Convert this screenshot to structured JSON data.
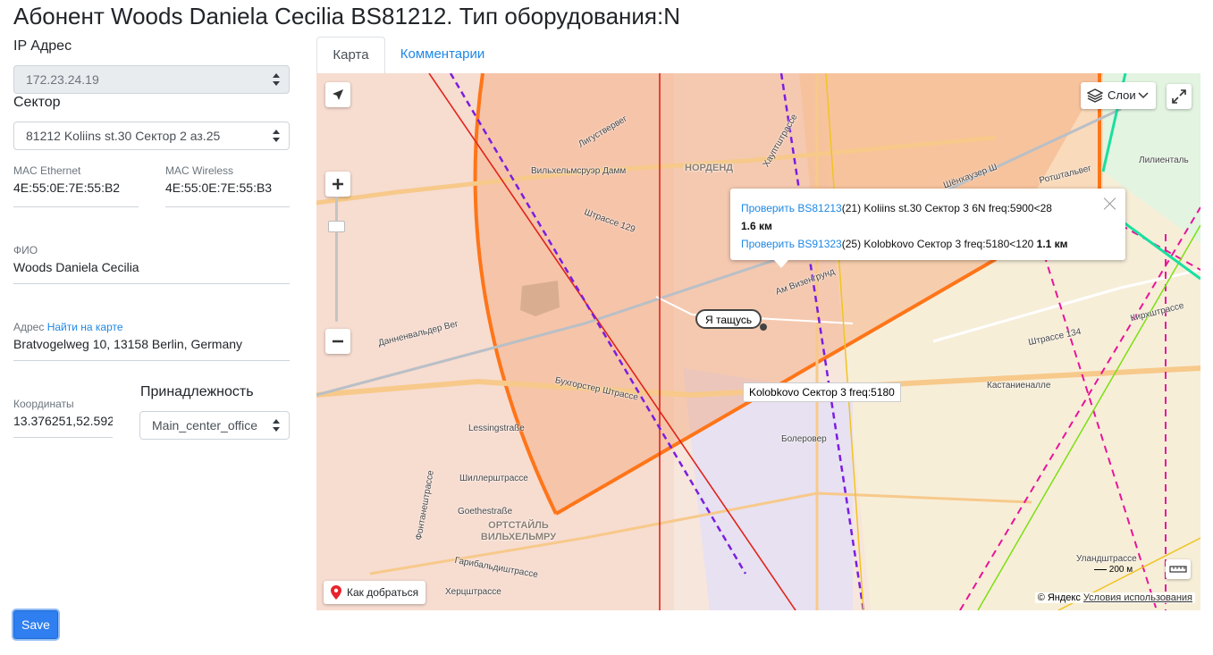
{
  "page": {
    "title": "Абонент Woods Daniela Cecilia BS81212. Тип оборудования:N"
  },
  "form": {
    "ip_label": "IP Адрес",
    "ip_value": "172.23.24.19",
    "sector_label": "Сектор",
    "sector_value": "81212 Koliins st.30 Сектор 2 аз.25",
    "mac_eth_label": "MAC Ethernet",
    "mac_eth_value": "4E:55:0E:7E:55:B2",
    "mac_wifi_label": "MAC Wireless",
    "mac_wifi_value": "4E:55:0E:7E:55:B3",
    "fio_label": "ФИО",
    "fio_value": "Woods Daniela Cecilia",
    "address_label": "Адрес",
    "address_link": "Найти на карте",
    "address_value": "Bratvogelweg 10, 13158 Berlin, Germany",
    "coords_label": "Координаты",
    "coords_value": "13.376251,52.592",
    "owner_label": "Принадлежность",
    "owner_value": "Main_center_office",
    "save_label": "Save"
  },
  "tabs": [
    {
      "label": "Карта",
      "active": true
    },
    {
      "label": "Комментарии",
      "active": false
    }
  ],
  "map": {
    "layers_label": "Слои",
    "route_label": "Как добраться",
    "marker_label": "Я тащусь",
    "hint_label": "Kolobkovo Сектор 3 freq:5180",
    "scale_label": "200 м",
    "copyright_prefix": "© Яндекс",
    "copyright_link": "Условия использования",
    "popup": {
      "row1_link": "Проверить BS81213",
      "row1_text": "(21) Koliins st.30 Сектор 3 6N freq:5900<28",
      "row1_dist": "1.6 км",
      "row2_link": "Проверить BS91323",
      "row2_text": "(25) Kolobkovo Сектор 3 freq:5180<120",
      "row2_dist": "1.1 км"
    },
    "street_labels": [
      "Вильхельмсруэр Дамм",
      "НОРДЕНД",
      "Штрассе 129",
      "Ам Визенгрунд",
      "Данненвальдер Вег",
      "Бухгорстер Штрассе",
      "Lessingstraße",
      "Шиллерштрассе",
      "Goethestraße",
      "ОРТСТАЙЛЬ ВИЛЬХЕЛЬМРУ",
      "Гарибальдиштрассе",
      "Херцштрассе",
      "Кастаниеналле",
      "Штрассе 134",
      "Фонтанештрассе",
      "Болеровер",
      "Лигуствервег",
      "Хауптштрассе",
      "Шёнхаузер Ш",
      "Кирхштрассе",
      "Уландштрассе",
      "Ротштальвег",
      "Лилиенталь"
    ]
  },
  "colors": {
    "accent": "#1e88e5",
    "save_button": "#2f7ff0",
    "zone_orange": "#ff7518",
    "line_red": "#e0241b",
    "line_purple": "#7a1ee0",
    "line_magenta": "#e8149a",
    "line_green": "#7be012",
    "line_teal": "#19e0a0",
    "line_yellow": "#f0c420"
  }
}
